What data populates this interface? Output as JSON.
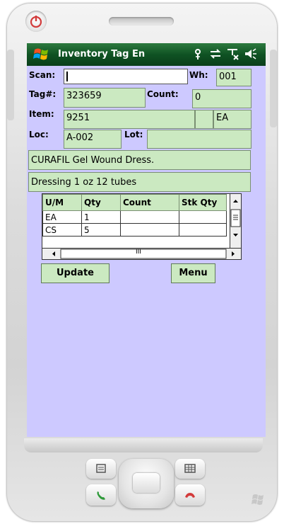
{
  "app": {
    "title": "Inventory Tag En"
  },
  "status_icons": [
    "antenna-icon",
    "sync-arrows-icon",
    "no-signal-icon",
    "volume-icon"
  ],
  "form": {
    "scan_label": "Scan:",
    "scan_value": "",
    "wh_label": "Wh:",
    "wh_value": "001",
    "tag_label": "Tag#:",
    "tag_value": "323659",
    "count_label": "Count:",
    "count_value": "0",
    "item_label": "Item:",
    "item_value": "9251",
    "item_uom": "EA",
    "loc_label": "Loc:",
    "loc_value": "A-002",
    "lot_label": "Lot:",
    "lot_value": "",
    "description1": "CURAFIL Gel Wound Dress.",
    "description2": "Dressing 1 oz  12 tubes"
  },
  "grid": {
    "columns": [
      "U/M",
      "Qty",
      "Count",
      "Stk Qty"
    ],
    "rows": [
      [
        "EA",
        "1",
        "",
        ""
      ],
      [
        "CS",
        "5",
        "",
        ""
      ]
    ],
    "scroll_thumb_glyph": "III"
  },
  "buttons": {
    "update_label": "Update",
    "menu_label": "Menu"
  },
  "colors": {
    "screen_bg": "#cdc9ff",
    "field_bg": "#cbe9c1",
    "title_bar": "#0f5223"
  }
}
